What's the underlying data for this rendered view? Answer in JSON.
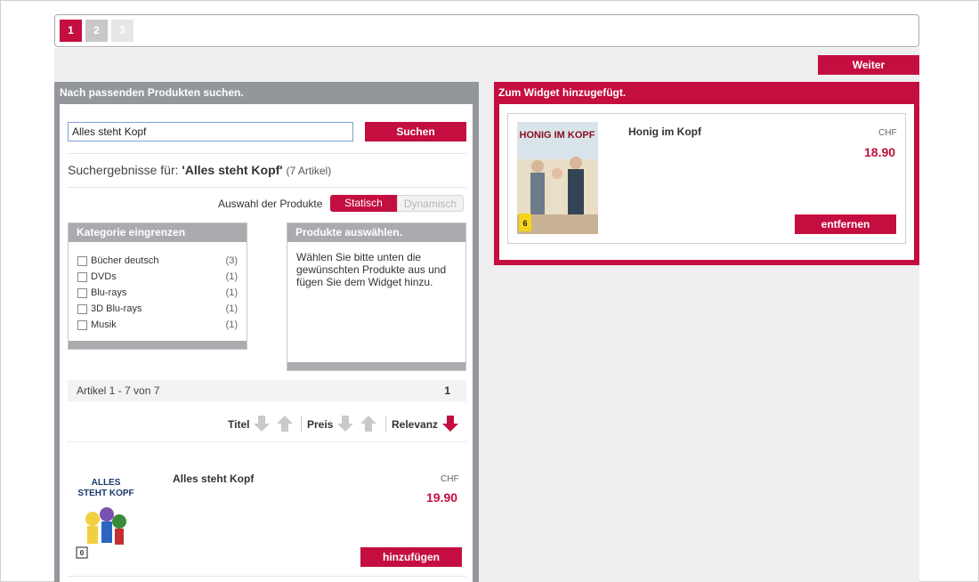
{
  "steps": [
    "1",
    "2",
    "3"
  ],
  "weiter_label": "Weiter",
  "left": {
    "header": "Nach passenden Produkten suchen.",
    "search_value": "Alles steht Kopf",
    "search_button": "Suchen",
    "results_prefix": "Suchergebnisse für: ",
    "results_query": "'Alles steht Kopf'",
    "results_count": "(7 Artikel)",
    "auswahl_label": "Auswahl der Produkte",
    "toggle_static": "Statisch",
    "toggle_dynamic": "Dynamisch",
    "categories_header": "Kategorie eingrenzen",
    "categories": [
      {
        "name": "Bücher deutsch",
        "count": "(3)"
      },
      {
        "name": "DVDs",
        "count": "(1)"
      },
      {
        "name": "Blu-rays",
        "count": "(1)"
      },
      {
        "name": "3D Blu-rays",
        "count": "(1)"
      },
      {
        "name": "Musik",
        "count": "(1)"
      }
    ],
    "products_header": "Produkte auswählen.",
    "products_text": "Wählen Sie bitte unten die gewünschten Produkte aus und fügen Sie dem Widget hinzu.",
    "pager_label": "Artikel 1 - 7 von 7",
    "pager_page": "1",
    "sort": {
      "title": "Titel",
      "price": "Preis",
      "relevance": "Relevanz"
    },
    "item": {
      "title": "Alles steht Kopf",
      "currency": "CHF",
      "price": "19.90",
      "button": "hinzufügen",
      "cover_text": "ALLES STEHT KOPF",
      "age_rating": "0"
    }
  },
  "right": {
    "header": "Zum Widget hinzugefügt.",
    "item": {
      "title": "Honig im Kopf",
      "currency": "CHF",
      "price": "18.90",
      "button": "entfernen",
      "cover_text": "HONIG IM KOPF",
      "age_rating": "6"
    }
  },
  "colors": {
    "accent": "#c40e3f",
    "panel_grey": "#93969b",
    "box_grey": "#a9abae",
    "page_band": "#efefef"
  }
}
